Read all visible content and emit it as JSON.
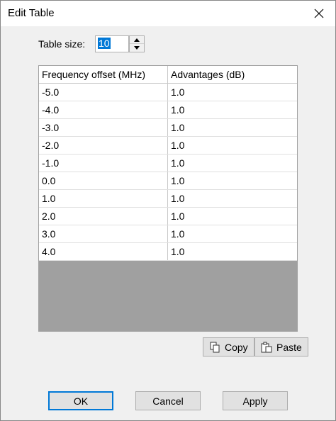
{
  "window": {
    "title": "Edit Table"
  },
  "table_size": {
    "label": "Table size:",
    "value": "10"
  },
  "grid": {
    "headers": [
      "Frequency offset (MHz)",
      "Advantages (dB)"
    ],
    "rows": [
      [
        "-5.0",
        "1.0"
      ],
      [
        "-4.0",
        "1.0"
      ],
      [
        "-3.0",
        "1.0"
      ],
      [
        "-2.0",
        "1.0"
      ],
      [
        "-1.0",
        "1.0"
      ],
      [
        "0.0",
        "1.0"
      ],
      [
        "1.0",
        "1.0"
      ],
      [
        "2.0",
        "1.0"
      ],
      [
        "3.0",
        "1.0"
      ],
      [
        "4.0",
        "1.0"
      ]
    ]
  },
  "toolbar": {
    "copy_label": "Copy",
    "paste_label": "Paste"
  },
  "buttons": {
    "ok": "OK",
    "cancel": "Cancel",
    "apply": "Apply"
  },
  "colors": {
    "accent": "#0078d7",
    "empty_grid": "#a0a0a0",
    "dialog_bg": "#f0f0f0"
  },
  "icons": {
    "close": "close-icon",
    "copy": "copy-icon",
    "paste": "paste-icon",
    "spin_up": "chevron-up-icon",
    "spin_down": "chevron-down-icon"
  }
}
